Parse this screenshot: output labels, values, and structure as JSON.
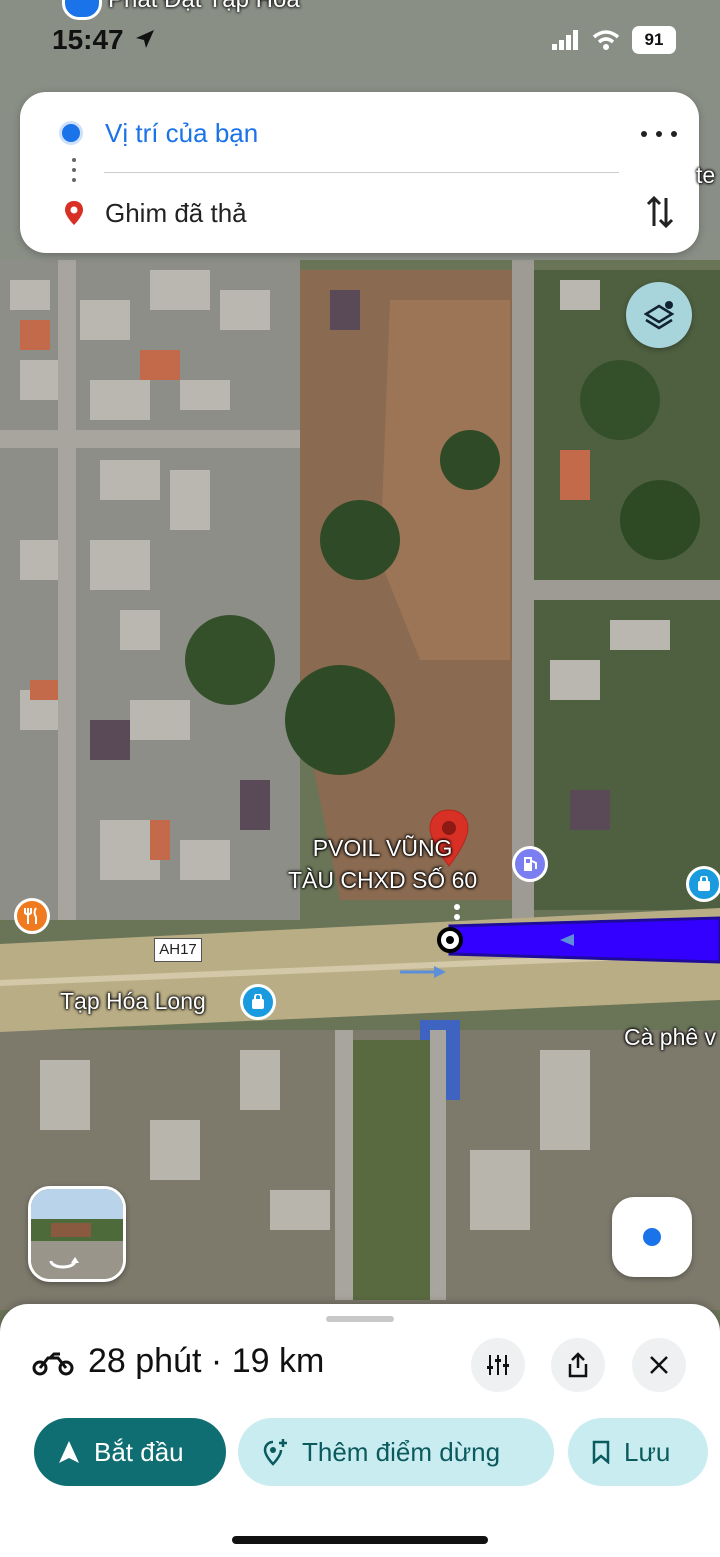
{
  "status_bar": {
    "time": "15:47",
    "battery": "91"
  },
  "map": {
    "top_place_label": "Phát Đạt Tạp Hóa",
    "edge_label_right": "te",
    "destination_label": "PVOIL VŨNG\nTÀU CHXD SỐ 60",
    "road_sign": "AH17",
    "shop_label": "Tạp Hóa Long",
    "cafe_label": "Cà phê v"
  },
  "route_card": {
    "origin": "Vị trí của bạn",
    "destination": "Ghim đã thả"
  },
  "sheet": {
    "duration": "28 phút",
    "separator": "·",
    "distance": "19 km",
    "start_label": "Bắt đầu",
    "add_stop_label": "Thêm điểm dừng",
    "save_label": "Lưu"
  },
  "colors": {
    "route": "#3300ff",
    "accent": "#1a73e8",
    "start_button": "#0f6e72",
    "secondary_button": "#c9ecf1",
    "destination_pin": "#d93025"
  }
}
